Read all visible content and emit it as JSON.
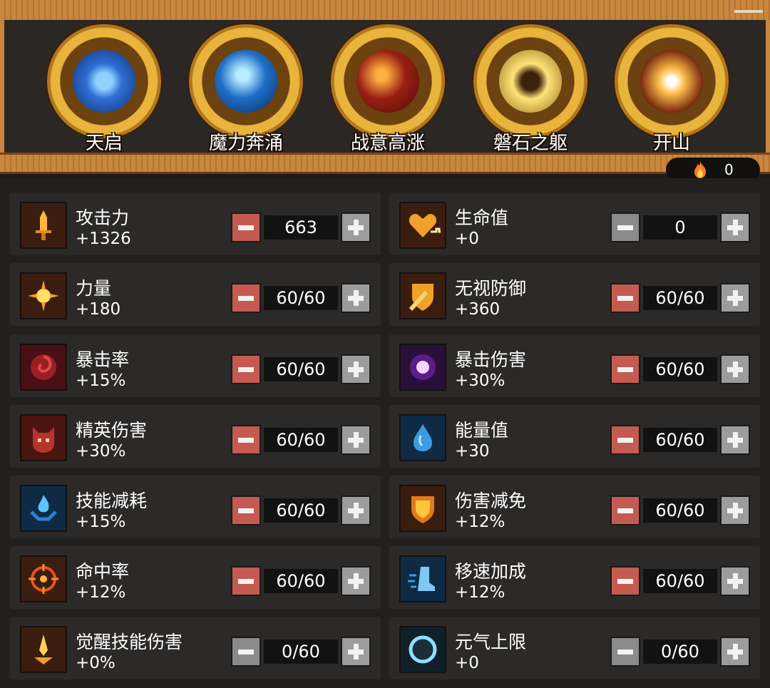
{
  "skills": [
    {
      "label": "天启",
      "icon": "meditating-figure-icon",
      "color": "#2f6fd6"
    },
    {
      "label": "魔力奔涌",
      "icon": "water-surge-icon",
      "color": "#1f6fc7"
    },
    {
      "label": "战意高涨",
      "icon": "war-spirit-icon",
      "color": "#9a1f14"
    },
    {
      "label": "磐石之躯",
      "icon": "stone-body-icon",
      "color": "#9a6f16"
    },
    {
      "label": "开山",
      "icon": "mountain-split-icon",
      "color": "#7a2a10"
    }
  ],
  "counter": {
    "icon": "flame-icon",
    "value": "0"
  },
  "stats": [
    {
      "name": "攻击力",
      "bonus": "+1326",
      "value": "663",
      "icon": "sword-icon",
      "minus_enabled": true
    },
    {
      "name": "生命值",
      "bonus": "+0",
      "value": "0",
      "icon": "heart-icon",
      "minus_enabled": false
    },
    {
      "name": "力量",
      "bonus": "+180",
      "value": "60/60",
      "icon": "sun-burst-icon",
      "minus_enabled": true
    },
    {
      "name": "无视防御",
      "bonus": "+360",
      "value": "60/60",
      "icon": "broken-shield-icon",
      "minus_enabled": true
    },
    {
      "name": "暴击率",
      "bonus": "+15%",
      "value": "60/60",
      "icon": "red-vortex-icon",
      "minus_enabled": true
    },
    {
      "name": "暴击伤害",
      "bonus": "+30%",
      "value": "60/60",
      "icon": "purple-orb-icon",
      "minus_enabled": true
    },
    {
      "name": "精英伤害",
      "bonus": "+30%",
      "value": "60/60",
      "icon": "demon-skull-icon",
      "minus_enabled": true
    },
    {
      "name": "能量值",
      "bonus": "+30",
      "value": "60/60",
      "icon": "water-drop-icon",
      "minus_enabled": true
    },
    {
      "name": "技能减耗",
      "bonus": "+15%",
      "value": "60/60",
      "icon": "blue-flame-hand-icon",
      "minus_enabled": true
    },
    {
      "name": "伤害减免",
      "bonus": "+12%",
      "value": "60/60",
      "icon": "gold-shield-icon",
      "minus_enabled": true
    },
    {
      "name": "命中率",
      "bonus": "+12%",
      "value": "60/60",
      "icon": "crosshair-icon",
      "minus_enabled": true
    },
    {
      "name": "移速加成",
      "bonus": "+12%",
      "value": "60/60",
      "icon": "speed-boot-icon",
      "minus_enabled": true
    },
    {
      "name": "觉醒技能伤害",
      "bonus": "+0%",
      "value": "0/60",
      "icon": "golden-dagger-icon",
      "minus_enabled": false
    },
    {
      "name": "元气上限",
      "bonus": "+0",
      "value": "0/60",
      "icon": "blue-ring-icon",
      "minus_enabled": false
    }
  ]
}
